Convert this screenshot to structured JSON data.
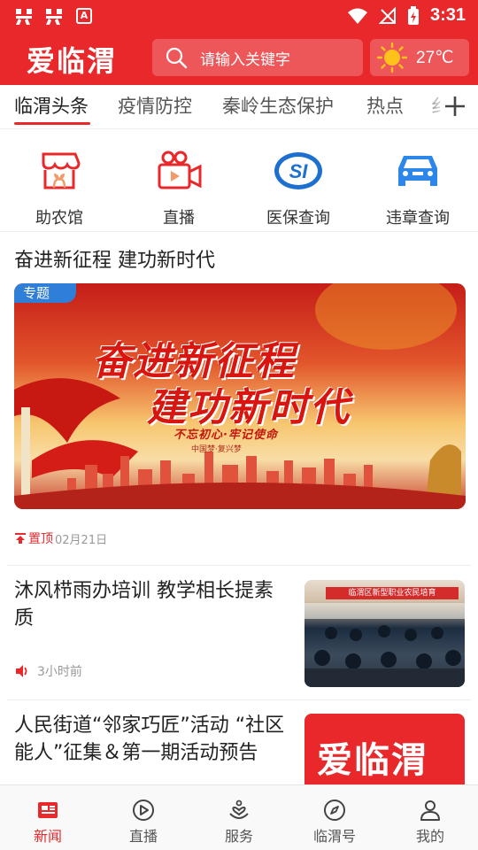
{
  "status_bar": {
    "time": "3:31",
    "app_badge": "A"
  },
  "header": {
    "brand": "爱临渭",
    "search_placeholder": "请输入关键字",
    "temperature": "27℃",
    "weather_icon": "sun-icon",
    "accent_color": "#e8282b"
  },
  "tabs": [
    {
      "label": "临渭头条",
      "active": true
    },
    {
      "label": "疫情防控",
      "active": false
    },
    {
      "label": "秦岭生态保护",
      "active": false
    },
    {
      "label": "热点",
      "active": false
    },
    {
      "label": "纟",
      "active": false
    }
  ],
  "shortcuts": [
    {
      "label": "助农馆",
      "icon": "shop-icon"
    },
    {
      "label": "直播",
      "icon": "video-camera-icon"
    },
    {
      "label": "医保查询",
      "icon": "medical-insurance-icon"
    },
    {
      "label": "违章查询",
      "icon": "car-icon"
    }
  ],
  "feed": {
    "section_title": "奋进新征程 建功新时代",
    "banner": {
      "tag": "专题",
      "line1": "奋进新征程",
      "line2": "建功新时代",
      "slogan": "不忘初心·牢记使命",
      "sub": "中国梦·复兴梦"
    },
    "pinned": {
      "label": "置顶",
      "date": "02月21日"
    },
    "articles": [
      {
        "title": "沐风栉雨办培训 教学相长提素质",
        "time": "3小时前",
        "thumb_banner": "临渭区新型职业农民培育"
      },
      {
        "title": "人民街道“邻家巧匠”活动 “社区能人”征集＆第一期活动预告",
        "thumb_text": "爱临渭"
      }
    ]
  },
  "bottom_nav": [
    {
      "label": "新闻",
      "icon": "news-icon",
      "active": true
    },
    {
      "label": "直播",
      "icon": "play-icon",
      "active": false
    },
    {
      "label": "服务",
      "icon": "service-icon",
      "active": false
    },
    {
      "label": "临渭号",
      "icon": "compass-icon",
      "active": false
    },
    {
      "label": "我的",
      "icon": "user-icon",
      "active": false
    }
  ]
}
